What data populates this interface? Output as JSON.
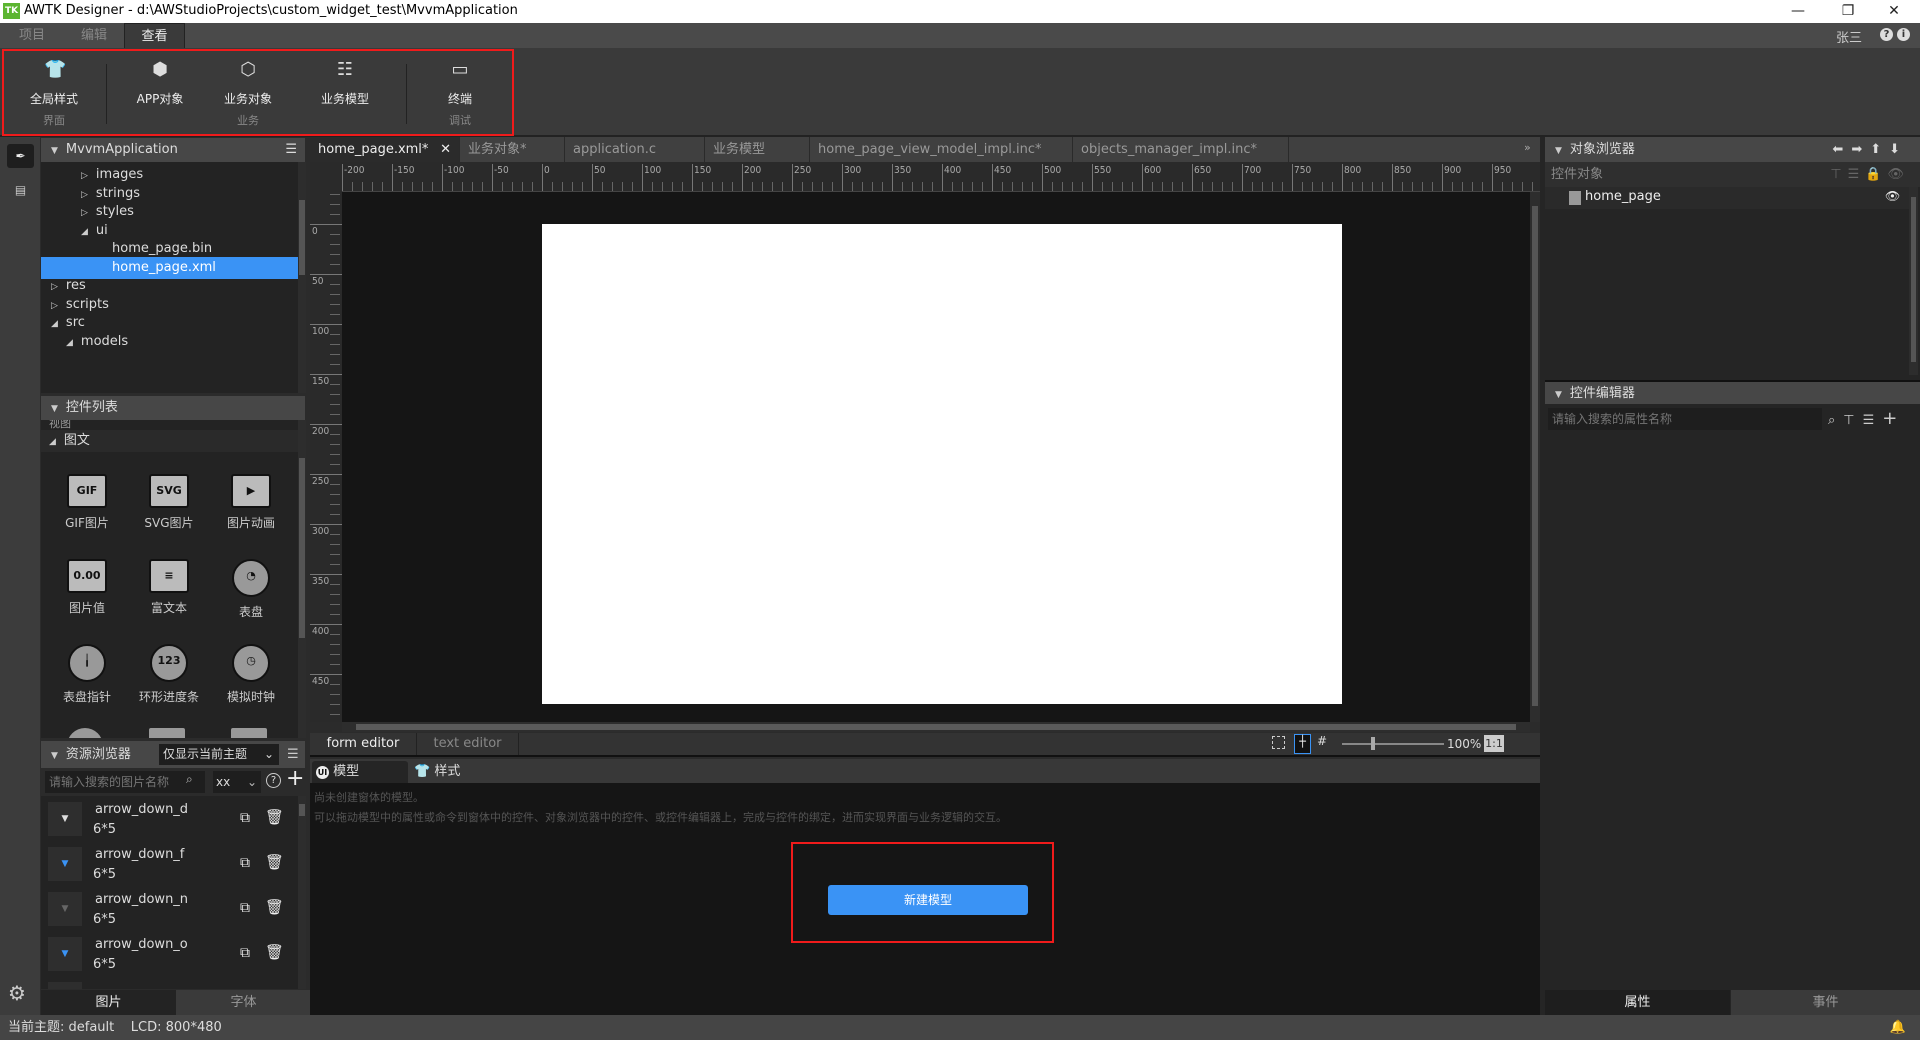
{
  "window": {
    "title": "AWTK Designer - d:\\AWStudioProjects\\custom_widget_test\\MvvmApplication",
    "logo": "TK",
    "minimize": "—",
    "restore": "❐",
    "close": "✕"
  },
  "menu": {
    "tabs": [
      "项目",
      "编辑",
      "查看"
    ],
    "active": "查看",
    "user": "张三",
    "help": "?",
    "info": "i"
  },
  "ribbon": {
    "buttons": [
      {
        "icon": "tshirt-icon",
        "label": "全局样式",
        "group": "界面"
      },
      {
        "icon": "hexagon-icon",
        "label": "APP对象",
        "group": ""
      },
      {
        "icon": "cube-icon",
        "label": "业务对象",
        "group": "业务"
      },
      {
        "icon": "list-icon",
        "label": "业务模型",
        "group": ""
      },
      {
        "icon": "terminal-icon",
        "label": "终端",
        "group": "调试"
      }
    ]
  },
  "project": {
    "title": "MvvmApplication",
    "tree": [
      {
        "label": "images",
        "level": 2,
        "expanded": false
      },
      {
        "label": "strings",
        "level": 2,
        "expanded": false
      },
      {
        "label": "styles",
        "level": 2,
        "expanded": false
      },
      {
        "label": "ui",
        "level": 2,
        "expanded": true
      },
      {
        "label": "home_page.bin",
        "level": 3
      },
      {
        "label": "home_page.xml",
        "level": 3,
        "selected": true
      },
      {
        "label": "res",
        "level": 0,
        "expanded": false
      },
      {
        "label": "scripts",
        "level": 0,
        "expanded": false
      },
      {
        "label": "src",
        "level": 0,
        "expanded": true
      },
      {
        "label": "models",
        "level": 1,
        "expanded": true
      }
    ]
  },
  "widgets": {
    "title": "控件列表",
    "cut_group": "视图",
    "group": "图文",
    "items": [
      {
        "label": "GIF图片",
        "glyph": "GIF"
      },
      {
        "label": "SVG图片",
        "glyph": "SVG"
      },
      {
        "label": "图片动画",
        "glyph": "▶"
      },
      {
        "label": "图片值",
        "glyph": "0.00"
      },
      {
        "label": "富文本",
        "glyph": "≡"
      },
      {
        "label": "表盘",
        "glyph": "◔"
      },
      {
        "label": "表盘指针",
        "glyph": "╽"
      },
      {
        "label": "环形进度条",
        "glyph": "123"
      },
      {
        "label": "模拟时钟",
        "glyph": "◷"
      }
    ]
  },
  "resources": {
    "title": "资源浏览器",
    "filter": "仅显示当前主题",
    "search_placeholder": "请输入搜索的图片名称",
    "theme_select": "xx",
    "items": [
      {
        "name": "arrow_down_d",
        "size": "6*5",
        "color": "#dddddd"
      },
      {
        "name": "arrow_down_f",
        "size": "6*5",
        "color": "#3a93f5"
      },
      {
        "name": "arrow_down_n",
        "size": "6*5",
        "color": "#666666"
      },
      {
        "name": "arrow_down_o",
        "size": "6*5",
        "color": "#3a93f5"
      }
    ],
    "tabs": [
      "图片",
      "字体"
    ]
  },
  "editor": {
    "tabs": [
      "home_page.xml*",
      "业务对象*",
      "application.c",
      "业务模型",
      "home_page_view_model_impl.inc*",
      "objects_manager_impl.inc*"
    ],
    "h_ruler": [
      "-200",
      "-150",
      "-100",
      "-50",
      "0",
      "50",
      "100",
      "150",
      "200",
      "250",
      "300",
      "350",
      "400",
      "450",
      "500",
      "550",
      "600",
      "650",
      "700",
      "750",
      "800",
      "850",
      "900",
      "950"
    ],
    "v_ruler": [
      "0",
      "50",
      "100",
      "150",
      "200",
      "250",
      "300",
      "350",
      "400",
      "450"
    ],
    "mode_tabs": [
      "form editor",
      "text editor"
    ],
    "zoom": "100%",
    "zoom_reset": "1:1",
    "zoom_level_percent": 100
  },
  "model_panel": {
    "tabs": [
      "模型",
      "样式"
    ],
    "line1": "尚未创建窗体的模型。",
    "line2": "可以拖动模型中的属性或命令到窗体中的控件、对象浏览器中的控件、或控件编辑器上，完成与控件的绑定，进而实现界面与业务逻辑的交互。",
    "new_button": "新建模型"
  },
  "object_browser": {
    "title": "对象浏览器",
    "sub": "控件对象",
    "items": [
      "home_page"
    ]
  },
  "widget_editor": {
    "title": "控件编辑器",
    "search_placeholder": "请输入搜索的属性名称",
    "tabs": [
      "属性",
      "事件"
    ]
  },
  "status": {
    "text": "当前主题: default    LCD: 800*480"
  },
  "colors": {
    "accent": "#3a93f5",
    "highlight": "#f01b1b"
  }
}
